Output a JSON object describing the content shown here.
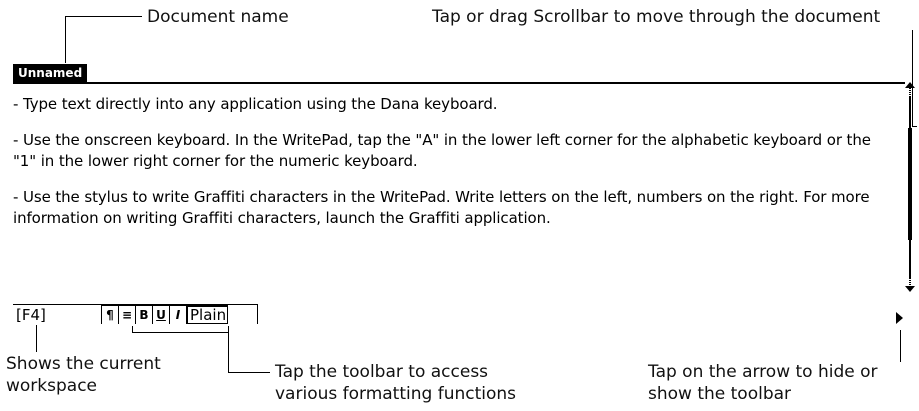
{
  "callouts": {
    "document_name": "Document name",
    "scrollbar": "Tap or drag Scrollbar to move through the document",
    "workspace_line1": "Shows the current",
    "workspace_line2": "workspace",
    "toolbar_line1": "Tap the toolbar to access",
    "toolbar_line2": "various formatting functions",
    "arrow_line1": "Tap on the arrow to hide or",
    "arrow_line2": "show the toolbar"
  },
  "window": {
    "title": "Unnamed"
  },
  "document": {
    "paragraphs": [
      "- Type text directly into any application using the Dana keyboard.",
      "- Use the onscreen keyboard.  In the WritePad, tap the \"A\" in the lower left corner for the alphabetic keyboard or the \"1\" in the lower right corner for the numeric keyboard.",
      "- Use the stylus to write Graffiti characters in the WritePad.  Write letters on the left, numbers on the right.  For more information on writing Graffiti characters, launch the Graffiti application."
    ]
  },
  "toolbar": {
    "workspace": "[F4]",
    "paragraph_icon": "¶",
    "align_icon": "≡",
    "bold": "B",
    "underline": "U",
    "italic": "I",
    "style": "Plain"
  },
  "icons": {
    "scroll_up": "scroll-up-arrow-icon",
    "scroll_down": "scroll-down-arrow-icon",
    "toolbar_toggle": "toolbar-toggle-arrow-icon"
  }
}
